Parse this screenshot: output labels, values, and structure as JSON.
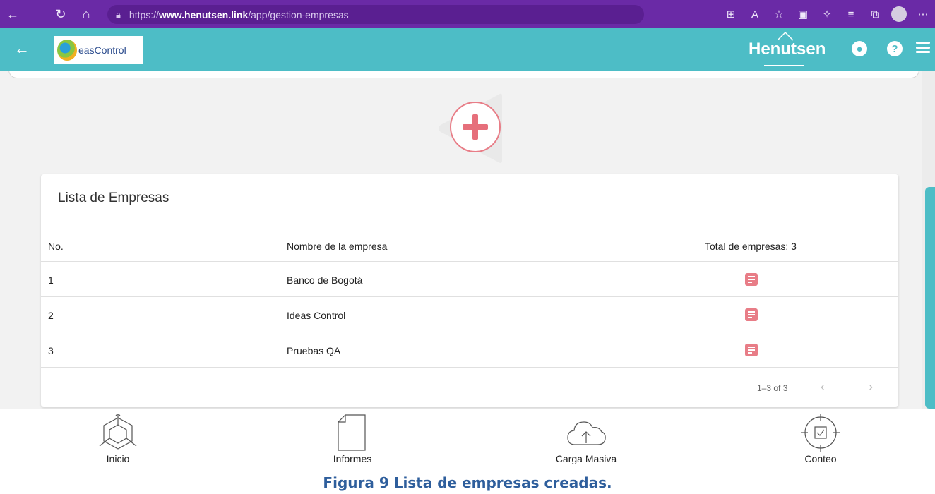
{
  "browser": {
    "url_prefix": "https://",
    "url_domain": "www.henutsen.link",
    "url_path": "/app/gestion-empresas"
  },
  "header": {
    "logo_text": "easControl",
    "brand": "Henutsen",
    "user_icon": "user-circle-icon",
    "help_icon": "help-circle-icon",
    "menu_icon": "hamburger-menu-icon"
  },
  "colors": {
    "header": "#4dbdc6",
    "browser": "#6a2aa6",
    "accent_red": "#e87d87",
    "caption": "#2e5e9c"
  },
  "list": {
    "title": "Lista de Empresas",
    "headers": {
      "no": "No.",
      "name": "Nombre de la empresa",
      "total": "Total de empresas: 3"
    },
    "rows": [
      {
        "no": "1",
        "name": "Banco de Bogotá"
      },
      {
        "no": "2",
        "name": "Ideas Control"
      },
      {
        "no": "3",
        "name": "Pruebas QA"
      }
    ],
    "pagination": "1–3 of 3"
  },
  "nav": {
    "items": [
      {
        "label": "Inicio",
        "icon": "cube-icon"
      },
      {
        "label": "Informes",
        "icon": "document-icon"
      },
      {
        "label": "Carga Masiva",
        "icon": "cloud-upload-icon"
      },
      {
        "label": "Conteo",
        "icon": "target-check-icon"
      }
    ]
  },
  "caption": "Figura 9 Lista de empresas creadas."
}
